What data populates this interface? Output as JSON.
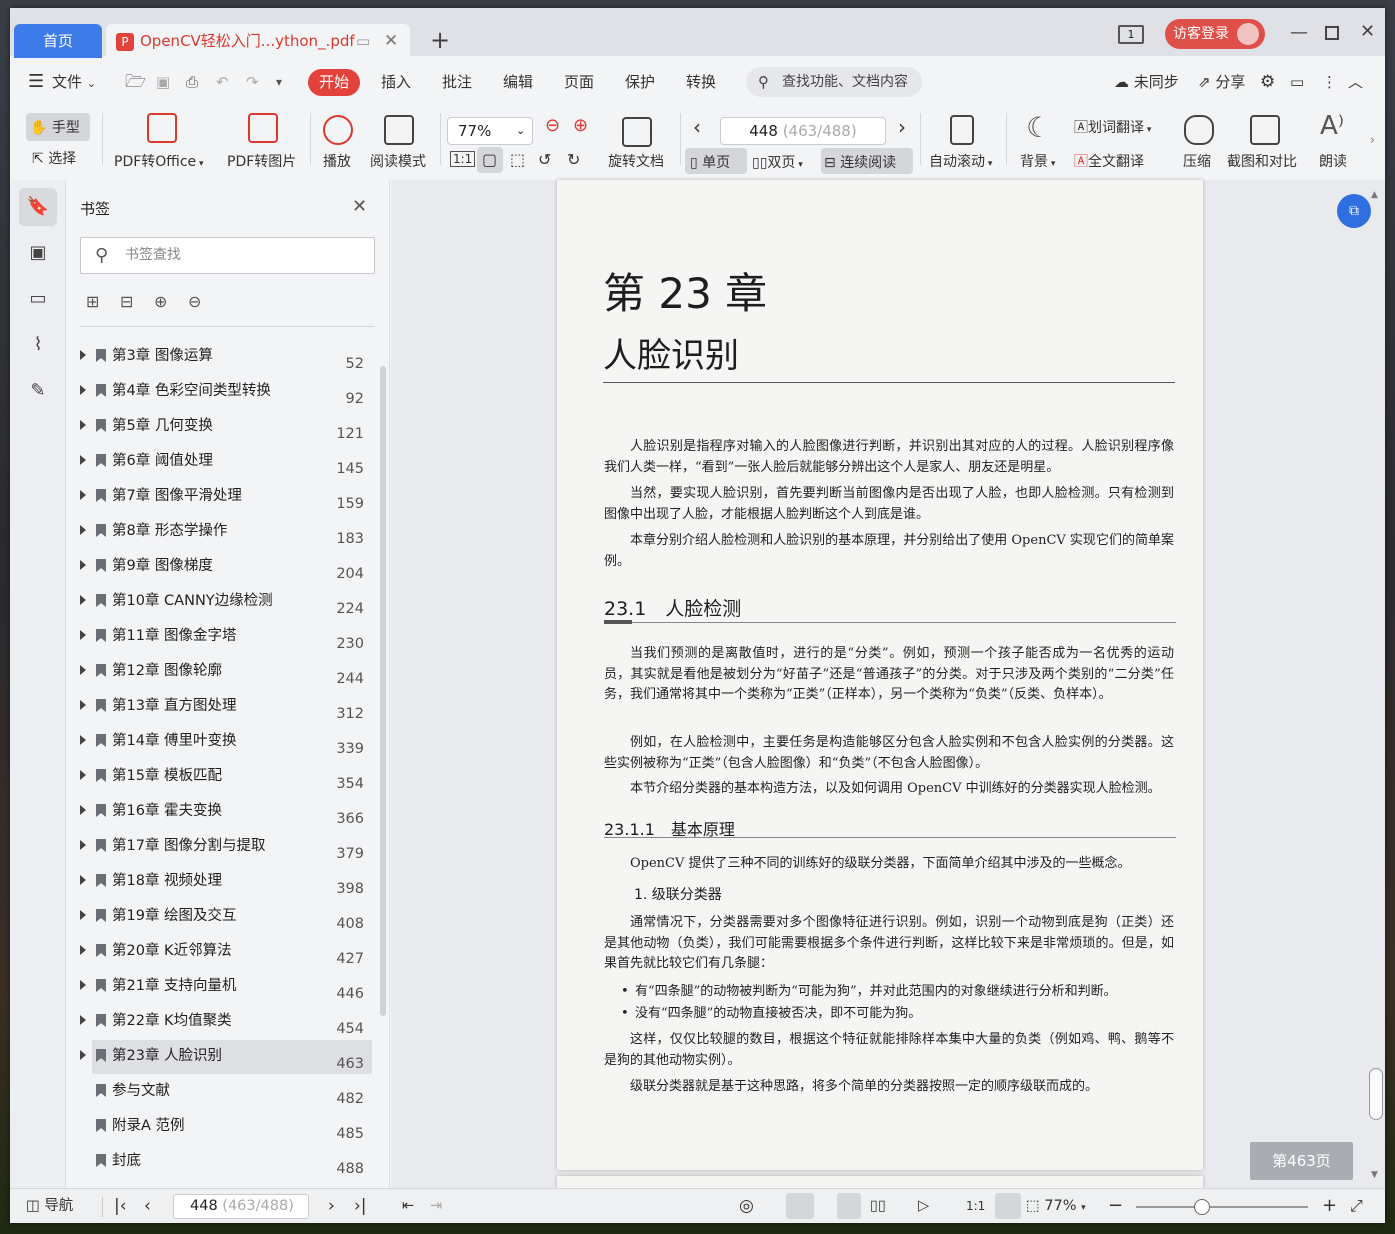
{
  "tabs": {
    "home": "首页",
    "doc_title": "OpenCV轻松入门...ython_.pdf"
  },
  "window": {
    "login": "访客登录",
    "page_icon_num": "1"
  },
  "menu": {
    "file": "文件",
    "start": "开始",
    "items": [
      "插入",
      "批注",
      "编辑",
      "页面",
      "保护",
      "转换"
    ],
    "search": "查找功能、文档内容",
    "sync": "未同步",
    "share": "分享"
  },
  "toolbar": {
    "hand": "手型",
    "select": "选择",
    "pdf_office": "PDF转Office",
    "pdf_image": "PDF转图片",
    "play": "播放",
    "read_mode": "阅读模式",
    "zoom": "77%",
    "rotate": "旋转文档",
    "page_value": "448",
    "page_hint": "(463/488)",
    "single": "单页",
    "double": "双页",
    "continuous": "连续阅读",
    "autoscroll": "自动滚动",
    "bg": "背景",
    "word_trans": "划词翻译",
    "full_trans": "全文翻译",
    "compress": "压缩",
    "screenshot": "截图和对比",
    "read_aloud": "朗读"
  },
  "sidebar": {
    "title": "书签",
    "search_placeholder": "书签查找",
    "items": [
      {
        "label": "第3章 图像运算",
        "page": "52"
      },
      {
        "label": "第4章 色彩空间类型转换",
        "page": "92"
      },
      {
        "label": "第5章 几何变换",
        "page": "121"
      },
      {
        "label": "第6章 阈值处理",
        "page": "145"
      },
      {
        "label": "第7章 图像平滑处理",
        "page": "159"
      },
      {
        "label": "第8章 形态学操作",
        "page": "183"
      },
      {
        "label": "第9章 图像梯度",
        "page": "204"
      },
      {
        "label": "第10章 CANNY边缘检测",
        "page": "224"
      },
      {
        "label": "第11章 图像金字塔",
        "page": "230"
      },
      {
        "label": "第12章 图像轮廓",
        "page": "244"
      },
      {
        "label": "第13章 直方图处理",
        "page": "312"
      },
      {
        "label": "第14章 傅里叶变换",
        "page": "339"
      },
      {
        "label": "第15章 模板匹配",
        "page": "354"
      },
      {
        "label": "第16章 霍夫变换",
        "page": "366"
      },
      {
        "label": "第17章 图像分割与提取",
        "page": "379"
      },
      {
        "label": "第18章 视频处理",
        "page": "398"
      },
      {
        "label": "第19章 绘图及交互",
        "page": "408"
      },
      {
        "label": "第20章 K近邻算法",
        "page": "427"
      },
      {
        "label": "第21章 支持向量机",
        "page": "446"
      },
      {
        "label": "第22章 K均值聚类",
        "page": "454"
      },
      {
        "label": "第23章 人脸识别",
        "page": "463"
      },
      {
        "label": "参与文献",
        "page": "482"
      },
      {
        "label": "附录A 范例",
        "page": "485"
      },
      {
        "label": "封底",
        "page": "488"
      }
    ]
  },
  "page": {
    "chapter": "第 23 章",
    "chapter_title": "人脸识别",
    "intro1": "人脸识别是指程序对输入的人脸图像进行判断，并识别出其对应的人的过程。人脸识别程序像我们人类一样，“看到”一张人脸后就能够分辨出这个人是家人、朋友还是明星。",
    "intro2": "当然，要实现人脸识别，首先要判断当前图像内是否出现了人脸，也即人脸检测。只有检测到图像中出现了人脸，才能根据人脸判断这个人到底是谁。",
    "intro3": "本章分别介绍人脸检测和人脸识别的基本原理，并分别给出了使用 OpenCV 实现它们的简单案例。",
    "sec1": "23.1　人脸检测",
    "s1p1": "当我们预测的是离散值时，进行的是“分类”。例如，预测一个孩子能否成为一名优秀的运动员，其实就是看他是被划分为“好苗子”还是“普通孩子”的分类。对于只涉及两个类别的“二分类”任务，我们通常将其中一个类称为“正类”（正样本），另一个类称为“负类”（反类、负样本）。",
    "s1p2": "例如，在人脸检测中，主要任务是构造能够区分包含人脸实例和不包含人脸实例的分类器。这些实例被称为“正类”（包含人脸图像）和“负类”（不包含人脸图像）。",
    "s1p3": "本节介绍分类器的基本构造方法，以及如何调用 OpenCV 中训练好的分类器实现人脸检测。",
    "sec11": "23.1.1　基本原理",
    "s11p1": "OpenCV 提供了三种不同的训练好的级联分类器，下面简单介绍其中涉及的一些概念。",
    "sub1": "1. 级联分类器",
    "s11p2": "通常情况下，分类器需要对多个图像特征进行识别。例如，识别一个动物到底是狗（正类）还是其他动物（负类），我们可能需要根据多个条件进行判断，这样比较下来是非常烦琐的。但是，如果首先就比较它们有几条腿：",
    "bullet1": "有“四条腿”的动物被判断为“可能为狗”，并对此范围内的对象继续进行分析和判断。",
    "bullet2": "没有“四条腿”的动物直接被否决，即不可能为狗。",
    "s11p3": "这样，仅仅比较腿的数目，根据这个特征就能排除样本集中大量的负类（例如鸡、鸭、鹅等不是狗的其他动物实例）。",
    "s11p4": "级联分类器就是基于这种思路，将多个简单的分类器按照一定的顺序级联而成的。"
  },
  "float_page": "第463页",
  "status": {
    "nav": "导航",
    "page_value": "448",
    "page_hint": "(463/488)",
    "zoom": "77%"
  }
}
